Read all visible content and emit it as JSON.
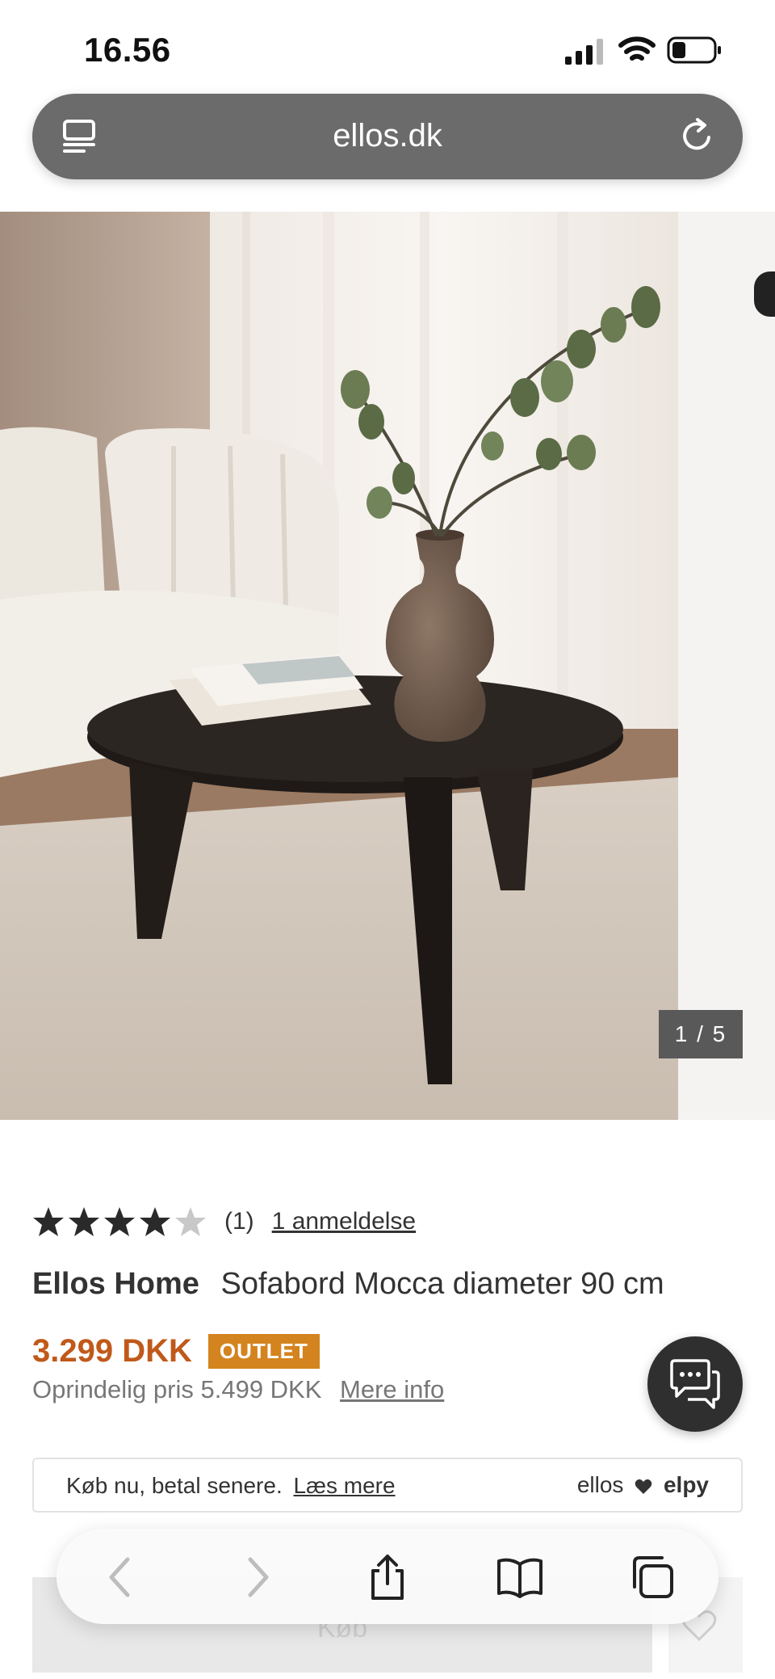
{
  "status_bar": {
    "time": "16.56"
  },
  "browser": {
    "url": "ellos.dk"
  },
  "gallery": {
    "counter": "1 / 5"
  },
  "product": {
    "rating": {
      "value": 4,
      "max": 5,
      "count_text": "(1)",
      "reviews_link": "1 anmeldelse"
    },
    "brand": "Ellos Home",
    "name": "Sofabord Mocca diameter 90 cm",
    "price": "3.299 DKK",
    "badge": "OUTLET",
    "original_price": "Oprindelig pris 5.499 DKK",
    "more_info": "Mere info"
  },
  "bnpl": {
    "text": "Køb nu, betal senere.",
    "link": "Læs mere",
    "logo_left": "ellos",
    "logo_right": "elpy"
  },
  "buy": {
    "label": "Køb"
  },
  "colors": {
    "price": "#c0591a",
    "badge": "#d4841f",
    "url_bar": "#6b6b6b",
    "chat": "#2f2f2f"
  },
  "icons": [
    "reader-icon",
    "reload-icon",
    "star-icon",
    "chat-icon",
    "heart-icon",
    "back-icon",
    "forward-icon",
    "share-icon",
    "bookmarks-icon",
    "tabs-icon"
  ]
}
